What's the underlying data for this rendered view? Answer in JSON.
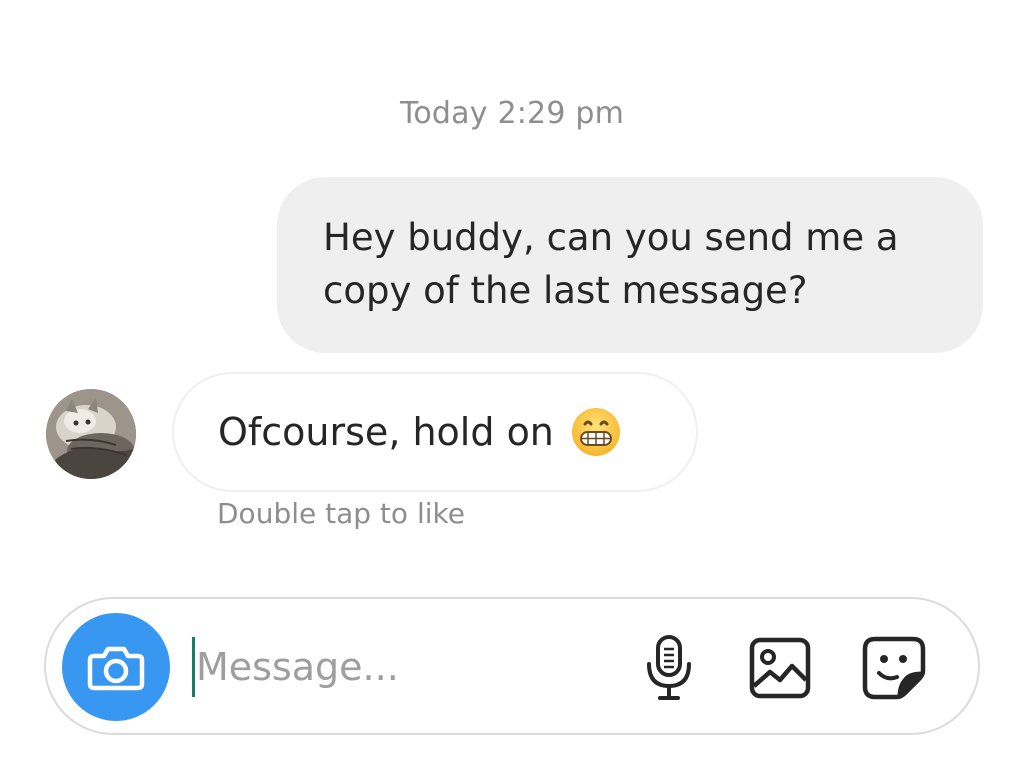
{
  "thread": {
    "timestamp": "Today 2:29 pm",
    "messages": [
      {
        "direction": "outgoing",
        "text": "Hey buddy, can you send me a copy of the last message?"
      },
      {
        "direction": "incoming",
        "text": "Ofcourse, hold on",
        "emoji": "grinning-face"
      }
    ],
    "like_hint": "Double tap to like"
  },
  "composer": {
    "placeholder": "Message...",
    "value": "",
    "buttons": {
      "camera": "camera-icon",
      "mic": "microphone-icon",
      "gallery": "image-icon",
      "sticker": "sticker-icon"
    }
  },
  "colors": {
    "accent": "#3897f0",
    "outgoing_bubble": "#efefef",
    "muted_text": "#8e8e8e",
    "caret": "#1b7a6e"
  }
}
